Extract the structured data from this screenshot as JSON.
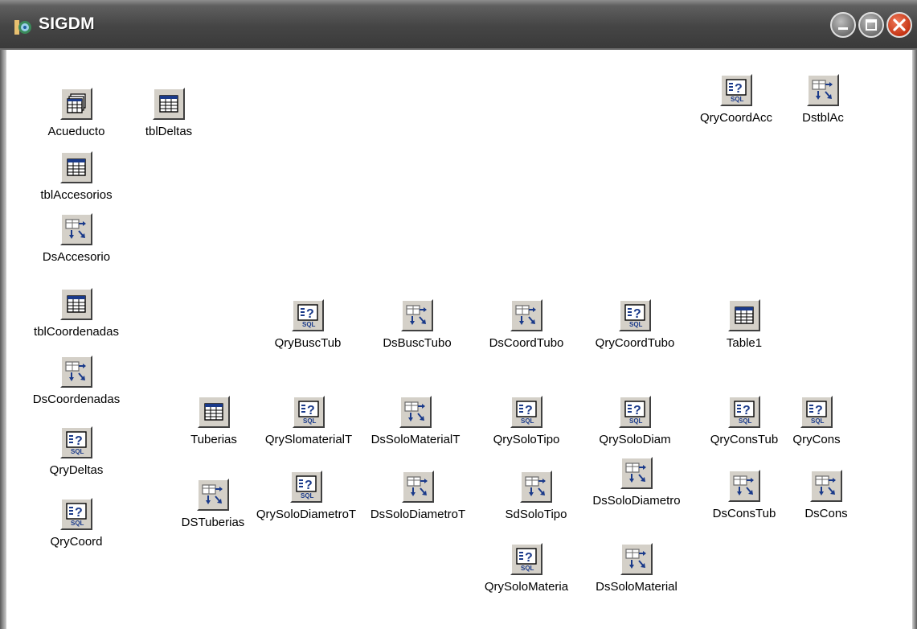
{
  "window": {
    "title": "SIGDM"
  },
  "titlebar_buttons": {
    "minimize": "minimize-icon",
    "maximize": "maximize-icon",
    "close": "close-icon"
  },
  "components": [
    {
      "label": "Acueducto",
      "icon": "database-icon"
    },
    {
      "label": "tblDeltas",
      "icon": "table-icon"
    },
    {
      "label": "tblAccesorios",
      "icon": "table-icon"
    },
    {
      "label": "DsAccesorio",
      "icon": "datasource-icon"
    },
    {
      "label": "tblCoordenadas",
      "icon": "table-icon"
    },
    {
      "label": "DsCoordenadas",
      "icon": "datasource-icon"
    },
    {
      "label": "QryDeltas",
      "icon": "sql-query-icon"
    },
    {
      "label": "QryCoord",
      "icon": "sql-query-icon"
    },
    {
      "label": "QryCoordAcc",
      "icon": "sql-query-icon"
    },
    {
      "label": "DstblAc",
      "icon": "datasource-icon"
    },
    {
      "label": "QryBuscTub",
      "icon": "sql-query-icon"
    },
    {
      "label": "DsBuscTubo",
      "icon": "datasource-icon"
    },
    {
      "label": "DsCoordTubo",
      "icon": "datasource-icon"
    },
    {
      "label": "QryCoordTubo",
      "icon": "sql-query-icon"
    },
    {
      "label": "Table1",
      "icon": "table-icon"
    },
    {
      "label": "Tuberias",
      "icon": "table-icon"
    },
    {
      "label": "QrySlomaterialT",
      "icon": "sql-query-icon"
    },
    {
      "label": "DsSoloMaterialT",
      "icon": "datasource-icon"
    },
    {
      "label": "QrySoloTipo",
      "icon": "sql-query-icon"
    },
    {
      "label": "QrySoloDiam",
      "icon": "sql-query-icon"
    },
    {
      "label": "QryConsTub",
      "icon": "sql-query-icon"
    },
    {
      "label": "QryCons",
      "icon": "sql-query-icon"
    },
    {
      "label": "DSTuberias",
      "icon": "datasource-icon"
    },
    {
      "label": "QrySoloDiametroT",
      "icon": "sql-query-icon"
    },
    {
      "label": "DsSoloDiametroT",
      "icon": "datasource-icon"
    },
    {
      "label": "SdSoloTipo",
      "icon": "datasource-icon"
    },
    {
      "label": "DsSoloDiametro",
      "icon": "datasource-icon"
    },
    {
      "label": "DsConsTub",
      "icon": "datasource-icon"
    },
    {
      "label": "DsCons",
      "icon": "datasource-icon"
    },
    {
      "label": "QrySoloMateria",
      "icon": "sql-query-icon"
    },
    {
      "label": "DsSoloMaterial",
      "icon": "datasource-icon"
    }
  ]
}
